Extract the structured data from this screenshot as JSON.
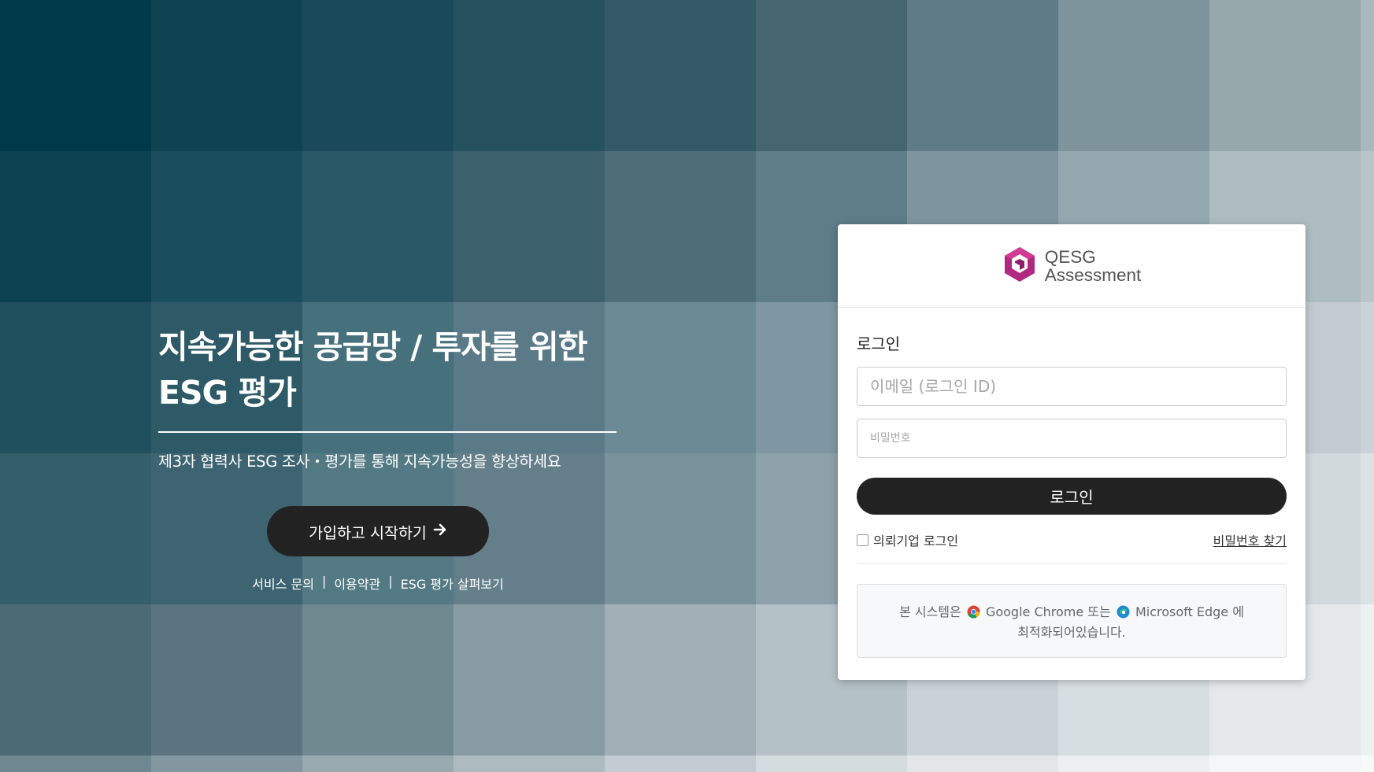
{
  "background": {
    "colors": [
      [
        "#003a4a",
        "#0f4352",
        "#1a4a59",
        "#26525f",
        "#345a68",
        "#45666f",
        "#5e7b86",
        "#7d949c",
        "#97a8ad",
        "#a9b8bd"
      ],
      [
        "#0c4150",
        "#1b4e5c",
        "#2a5866",
        "#3c616c",
        "#4d6d79",
        "#5f7d88",
        "#7e959f",
        "#95a8b0",
        "#adbdc2",
        "#bac5ca"
      ],
      [
        "#20505e",
        "#2e5967",
        "#45707c",
        "#5a7a87",
        "#6b8a95",
        "#7f97a2",
        "#94a6b0",
        "#adbcc3",
        "#c1cbd0",
        "#ccd3d8"
      ],
      [
        "#345e6a",
        "#3d6470",
        "#537a84",
        "#657f8a",
        "#7a929c",
        "#8da1aa",
        "#a7b7bf",
        "#bec9cf",
        "#d0d9dc",
        "#dde2e4"
      ],
      [
        "#4c6a74",
        "#5a7580",
        "#70888f",
        "#879ba2",
        "#a0b0b6",
        "#b4c1c6",
        "#c9d3d7",
        "#d7dee1",
        "#e4e8ea",
        "#eef1f2"
      ],
      [
        "#6e8791",
        "#8397a1",
        "#98a9b0",
        "#adbbc1",
        "#c3cdd1",
        "#d5dcdf",
        "#e3e7e9",
        "#edf0f1",
        "#f4f6f7",
        "#f8f9fa"
      ]
    ]
  },
  "hero": {
    "title_line1": "지속가능한 공급망 / 투자를 위한",
    "title_line2": "ESG 평가",
    "subtitle": "제3자 협력사 ESG 조사・평가를 통해 지속가능성을 향상하세요",
    "cta_label": "가입하고 시작하기",
    "cta_icon": "arrow-right-icon"
  },
  "footer_links": [
    "서비스 문의",
    "이용약관",
    "ESG 평가 살펴보기"
  ],
  "footer_separator": "|",
  "login_card": {
    "logo_line1": "QESG",
    "logo_line2": "Assessment",
    "title": "로그인",
    "email_placeholder": "이메일 (로그인 ID)",
    "password_placeholder": "비밀번호",
    "login_button": "로그인",
    "client_login_label": "의뢰기업 로그인",
    "find_password": "비밀번호 찾기",
    "notice_part1": "본 시스템은",
    "chrome": "Google Chrome",
    "notice_or": "또는",
    "edge": "Microsoft Edge",
    "notice_part2": "에",
    "notice_line2": "최적화되어있습니다."
  },
  "colors": {
    "logo_accent": "#b0287f",
    "button_dark": "#222222"
  }
}
